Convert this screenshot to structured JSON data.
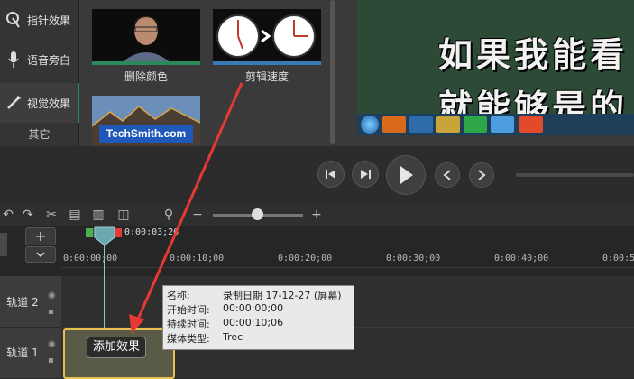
{
  "sidebar": {
    "items": [
      {
        "label": "指针效果",
        "icon": "cursor-effects-icon"
      },
      {
        "label": "语音旁白",
        "icon": "microphone-icon"
      },
      {
        "label": "视觉效果",
        "icon": "magic-wand-icon"
      }
    ],
    "other_label": "其它"
  },
  "library": {
    "thumbnails": [
      {
        "label": "删除颜色",
        "icon": "remove-color-thumbnail"
      },
      {
        "label": "剪辑速度",
        "icon": "clip-speed-thumbnail"
      },
      {
        "label": "",
        "logo_text": "TechSmith.com",
        "icon": "techsmith-thumbnail"
      }
    ]
  },
  "preview": {
    "subtitle_line1": "如果我能看",
    "subtitle_line2": "就能够是的"
  },
  "timeline": {
    "playhead_time": "0:00:03;26",
    "ruler_ticks": [
      "0:00:00;00",
      "0:00:10;00",
      "0:00:20;00",
      "0:00:30;00",
      "0:00:40;00",
      "0:00:50"
    ],
    "tracks": [
      {
        "label": "轨道 2"
      },
      {
        "label": "轨道 1"
      }
    ],
    "add_track_label": "+",
    "add_effect_label": "添加效果"
  },
  "tooltip": {
    "rows": [
      {
        "key": "名称:",
        "value": "录制日期 17-12-27 (屏幕)"
      },
      {
        "key": "开始时间:",
        "value": "00:00:00;00"
      },
      {
        "key": "持续时间:",
        "value": "00:00:10;06"
      },
      {
        "key": "媒体类型:",
        "value": "Trec"
      }
    ]
  },
  "colors": {
    "accent": "#e8c050",
    "arrow": "#e53935",
    "active_green": "#2b8a5a"
  }
}
